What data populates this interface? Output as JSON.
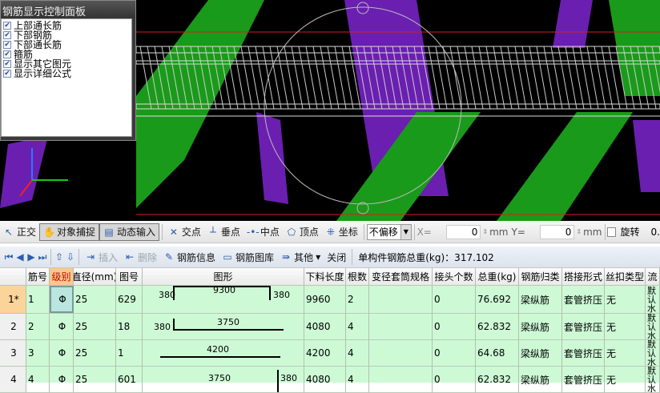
{
  "panel": {
    "title": "钢筋显示控制面板",
    "items": [
      "上部通长筋",
      "下部钢筋",
      "下部通长筋",
      "箍筋",
      "显示其它图元",
      "显示详细公式"
    ]
  },
  "toolbar1": {
    "ortho": "正交",
    "snap": "对象捕捉",
    "dyn": "动态输入",
    "intersect": "交点",
    "perp": "垂点",
    "mid": "中点",
    "vertex": "顶点",
    "coord": "坐标",
    "offset": "不偏移",
    "x_label": "X=",
    "x_value": "0",
    "unit1": "mm",
    "y_label": "Y=",
    "y_value": "0",
    "unit2": "mm",
    "rotate": "旋转",
    "rotate_value": "0."
  },
  "toolbar2": {
    "insert": "插入",
    "delete": "删除",
    "info": "钢筋信息",
    "library": "钢筋图库",
    "other": "其他",
    "close": "关闭",
    "total": "单构件钢筋总重(kg)：317.102"
  },
  "table": {
    "headers": [
      "",
      "筋号",
      "级别",
      "直径(mm)",
      "图号",
      "图形",
      "下料长度",
      "根数",
      "变径套筒规格",
      "接头个数",
      "总重(kg)",
      "钢筋归类",
      "搭接形式",
      "丝扣类型",
      "流"
    ],
    "rows": [
      {
        "rn": "1*",
        "no": "1",
        "grade": "Φ",
        "dia": "25",
        "fig": "629",
        "shape": {
          "left": "380",
          "mid": "9300",
          "right": "380"
        },
        "len": "9960",
        "count": "2",
        "reducer": "",
        "joints": "0",
        "weight": "76.692",
        "cls": "梁纵筋",
        "lap": "套管挤压",
        "thread": "无",
        "flow": "默认水"
      },
      {
        "rn": "2",
        "no": "2",
        "grade": "Φ",
        "dia": "25",
        "fig": "18",
        "shape": {
          "left": "380",
          "mid": "3750",
          "right": ""
        },
        "len": "4080",
        "count": "4",
        "reducer": "",
        "joints": "0",
        "weight": "62.832",
        "cls": "梁纵筋",
        "lap": "套管挤压",
        "thread": "无",
        "flow": "默认水"
      },
      {
        "rn": "3",
        "no": "3",
        "grade": "Φ",
        "dia": "25",
        "fig": "1",
        "shape": {
          "left": "",
          "mid": "4200",
          "right": ""
        },
        "len": "4200",
        "count": "4",
        "reducer": "",
        "joints": "0",
        "weight": "64.68",
        "cls": "梁纵筋",
        "lap": "套管挤压",
        "thread": "无",
        "flow": "默认水"
      },
      {
        "rn": "4",
        "no": "4",
        "grade": "Φ",
        "dia": "25",
        "fig": "601",
        "shape": {
          "left": "",
          "mid": "3750",
          "right": "380"
        },
        "len": "4080",
        "count": "4",
        "reducer": "",
        "joints": "0",
        "weight": "62.832",
        "cls": "梁纵筋",
        "lap": "套管挤压",
        "thread": "无",
        "flow": "默认水"
      }
    ]
  }
}
